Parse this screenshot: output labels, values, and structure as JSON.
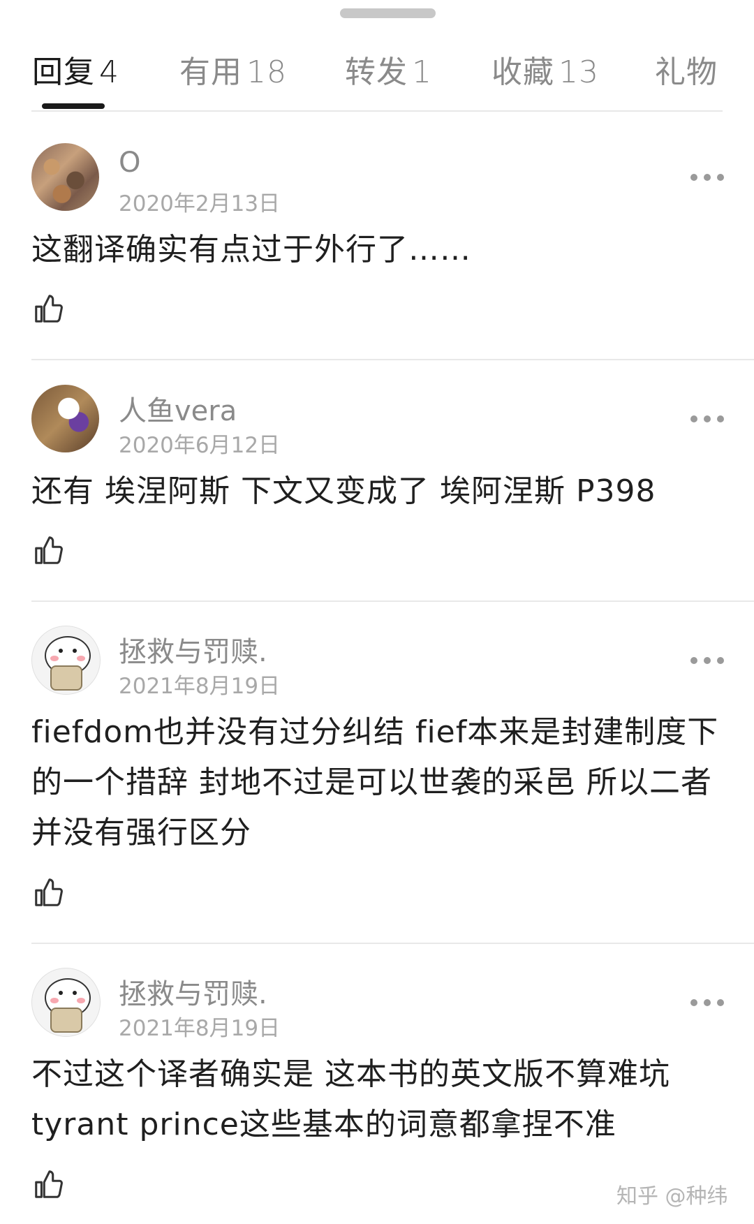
{
  "tabs": [
    {
      "label": "回复",
      "count": "4",
      "active": true
    },
    {
      "label": "有用",
      "count": "18",
      "active": false
    },
    {
      "label": "转发",
      "count": "1",
      "active": false
    },
    {
      "label": "收藏",
      "count": "13",
      "active": false
    },
    {
      "label": "礼物",
      "count": "",
      "active": false
    }
  ],
  "comments": [
    {
      "username": "O",
      "date": "2020年2月13日",
      "text": "这翻译确实有点过于外行了……"
    },
    {
      "username": "人鱼vera",
      "date": "2020年6月12日",
      "text": "还有 埃涅阿斯  下文又变成了 埃阿涅斯  P398"
    },
    {
      "username": "拯救与罚赎.",
      "date": "2021年8月19日",
      "text": "fiefdom也并没有过分纠结  fief本来是封建制度下的一个措辞  封地不过是可以世袭的采邑  所以二者并没有强行区分"
    },
    {
      "username": "拯救与罚赎.",
      "date": "2021年8月19日",
      "text": "不过这个译者确实是  这本书的英文版不算难坑 tyrant  prince这些基本的词意都拿捏不准"
    }
  ],
  "icons": {
    "like": "thumbs-up-icon",
    "more": "more-horizontal-icon"
  },
  "watermark": "知乎 @种纬"
}
